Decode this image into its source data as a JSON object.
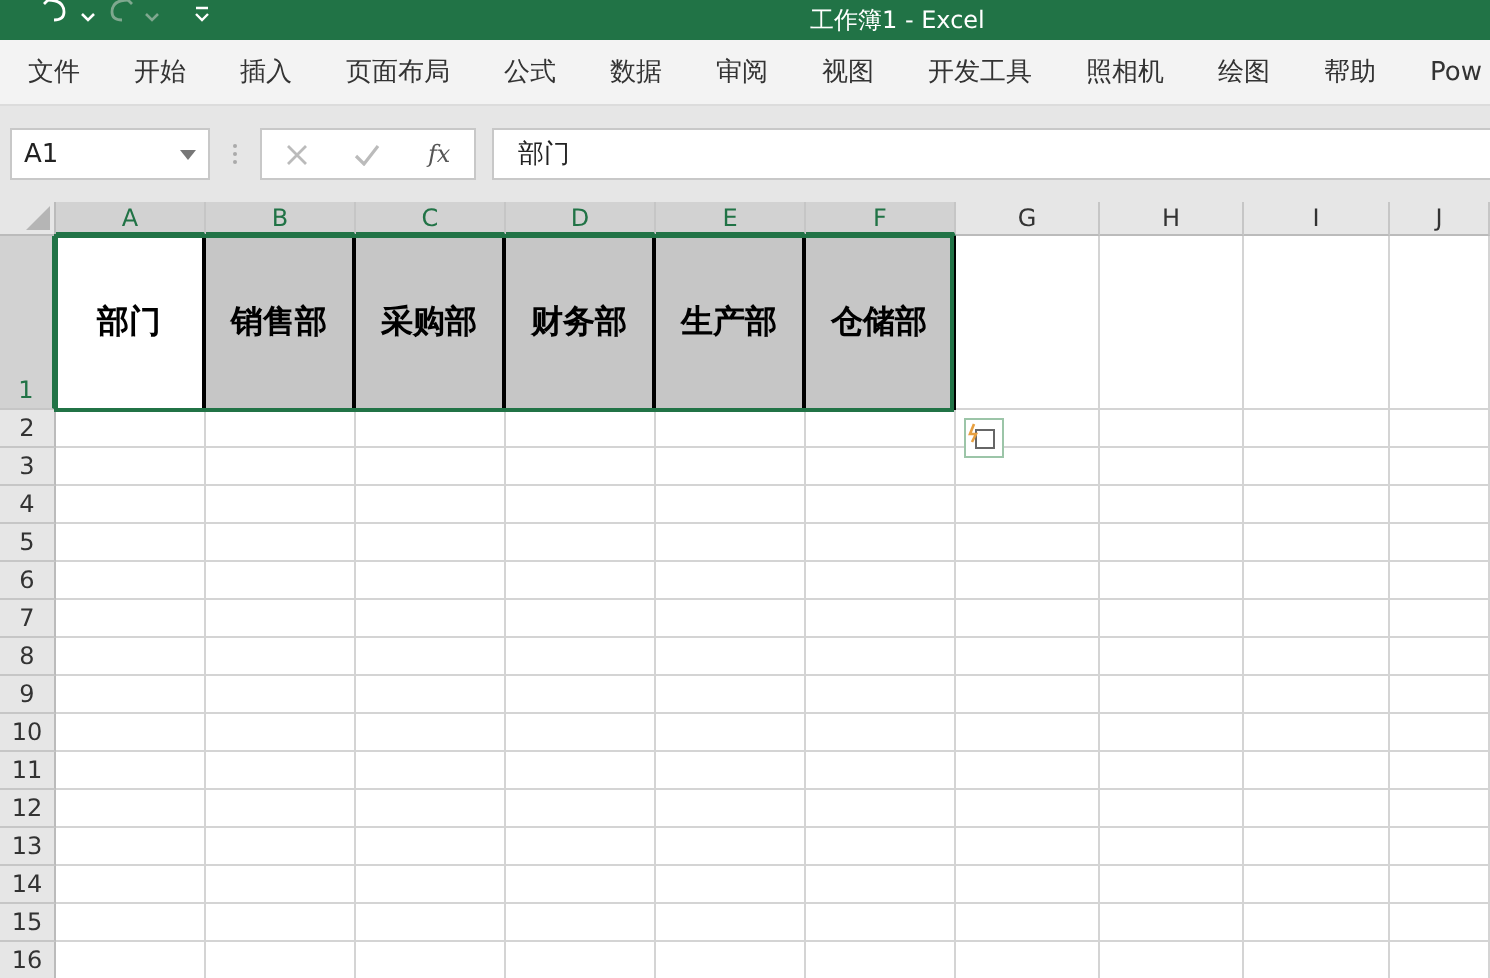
{
  "window": {
    "title": "工作簿1  -  Excel"
  },
  "ribbon_tabs": [
    {
      "label": "文件"
    },
    {
      "label": "开始"
    },
    {
      "label": "插入"
    },
    {
      "label": "页面布局"
    },
    {
      "label": "公式"
    },
    {
      "label": "数据"
    },
    {
      "label": "审阅"
    },
    {
      "label": "视图"
    },
    {
      "label": "开发工具"
    },
    {
      "label": "照相机"
    },
    {
      "label": "绘图"
    },
    {
      "label": "帮助"
    },
    {
      "label": "Pow"
    }
  ],
  "formula_bar": {
    "name_box": "A1",
    "fx": "fx",
    "formula": "部门"
  },
  "columns": [
    {
      "label": "A",
      "selected": true
    },
    {
      "label": "B",
      "selected": true
    },
    {
      "label": "C",
      "selected": true
    },
    {
      "label": "D",
      "selected": true
    },
    {
      "label": "E",
      "selected": true
    },
    {
      "label": "F",
      "selected": true
    },
    {
      "label": "G",
      "selected": false
    },
    {
      "label": "H",
      "selected": false
    },
    {
      "label": "I",
      "selected": false
    },
    {
      "label": "J",
      "selected": false
    }
  ],
  "rows": [
    {
      "label": "1",
      "selected": true,
      "cells": [
        {
          "text": "部门",
          "shaded": false
        },
        {
          "text": "销售部",
          "shaded": true
        },
        {
          "text": "采购部",
          "shaded": true
        },
        {
          "text": "财务部",
          "shaded": true
        },
        {
          "text": "生产部",
          "shaded": true
        },
        {
          "text": "仓储部",
          "shaded": true
        }
      ]
    },
    {
      "label": "2",
      "selected": false
    },
    {
      "label": "3",
      "selected": false
    },
    {
      "label": "4",
      "selected": false
    },
    {
      "label": "5",
      "selected": false
    },
    {
      "label": "6",
      "selected": false
    },
    {
      "label": "7",
      "selected": false
    },
    {
      "label": "8",
      "selected": false
    },
    {
      "label": "9",
      "selected": false
    },
    {
      "label": "10",
      "selected": false
    },
    {
      "label": "11",
      "selected": false
    },
    {
      "label": "12",
      "selected": false
    },
    {
      "label": "13",
      "selected": false
    },
    {
      "label": "14",
      "selected": false
    },
    {
      "label": "15",
      "selected": false
    },
    {
      "label": "16",
      "selected": false
    }
  ]
}
